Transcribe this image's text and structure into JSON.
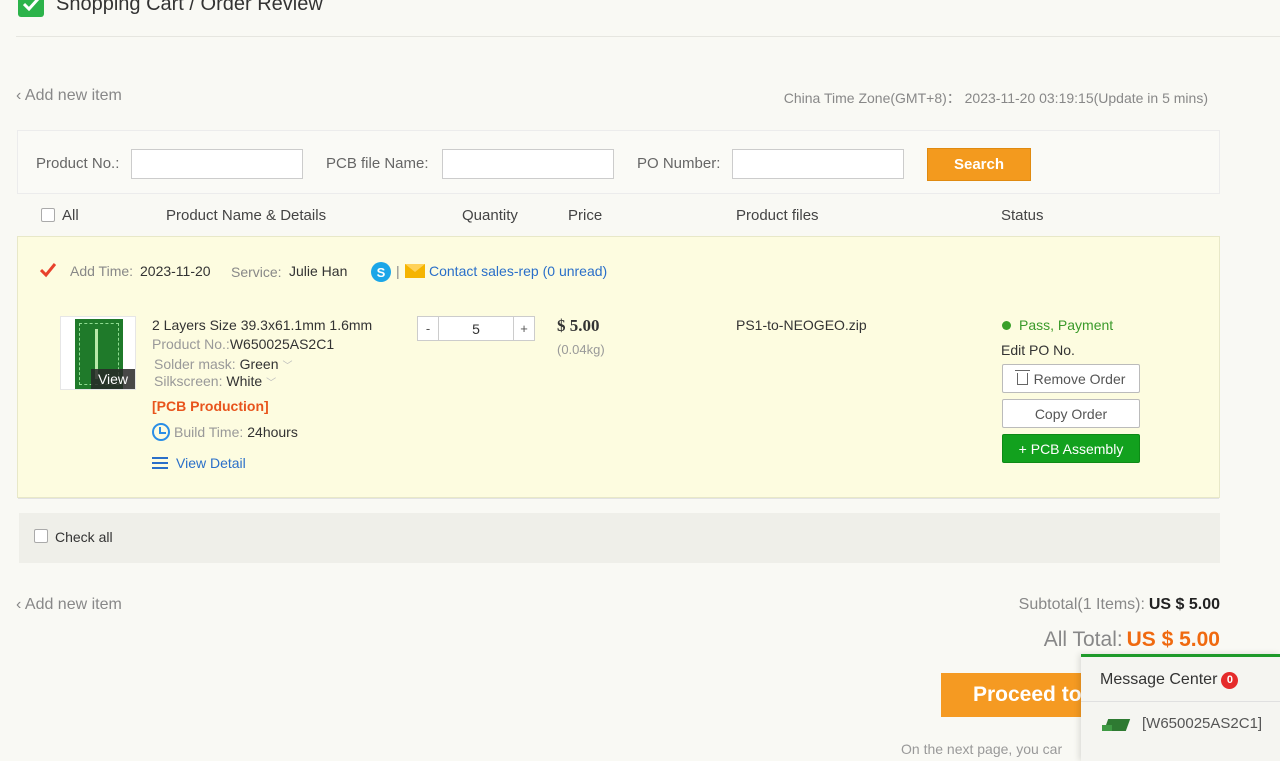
{
  "page": {
    "title": "Shopping Cart / Order Review",
    "add_new_item": "Add new item",
    "timezone_note": "China Time Zone(GMT+8)： 2023-11-20 03:19:15(Update in 5 mins)"
  },
  "search": {
    "product_no_label": "Product No.:",
    "pcb_file_label": "PCB file Name:",
    "po_number_label": "PO Number:",
    "product_no_value": "",
    "pcb_file_value": "",
    "po_number_value": "",
    "button": "Search"
  },
  "table_header": {
    "all": "All",
    "columns": [
      "Product Name & Details",
      "Quantity",
      "Price",
      "Product files",
      "Status"
    ]
  },
  "order": {
    "add_time_label": "Add Time:",
    "add_time": "2023-11-20",
    "service_label": "Service:",
    "service": "Julie Han",
    "separator": "|",
    "contact": "Contact sales-rep (0 unread)",
    "view_tag": "View",
    "spec": "2 Layers Size 39.3x61.1mm 1.6mm",
    "product_no_label": "Product No.:",
    "product_no": "W650025AS2C1",
    "solder_label": "Solder mask:",
    "solder": "Green",
    "silk_label": "Silkscreen:",
    "silk": "White",
    "production": "[PCB Production]",
    "build_label": "Build Time:",
    "build": "24hours",
    "view_detail": "View Detail",
    "quantity_minus": "-",
    "quantity": "5",
    "quantity_plus": "+",
    "price": "$ 5.00",
    "weight": "(0.04kg)",
    "file": "PS1-to-NEOGEO.zip",
    "status": "Pass, Payment",
    "edit_po": "Edit PO No.",
    "remove": "Remove Order",
    "copy": "Copy Order",
    "assembly": "+ PCB Assembly"
  },
  "footer": {
    "check_all": "Check all",
    "subtotal_label": "Subtotal(1 Items):",
    "subtotal": "US $ 5.00",
    "total_label": "All Total:",
    "total": "US $ 5.00",
    "proceed": "Proceed to",
    "next_note": "On the next page, you car"
  },
  "message_center": {
    "title": "Message Center",
    "count": "0",
    "item": "[W650025AS2C1]"
  },
  "colors": {
    "accent_orange": "#f39a1e",
    "total_orange": "#f06a10",
    "status_green": "#3a9a2a",
    "assembly_green": "#12a11e",
    "link_blue": "#2a6fc9",
    "order_panel_bg": "#fdfce0"
  },
  "icons": [
    "checkbox-checked-icon",
    "skype-icon",
    "mail-icon",
    "clock-icon",
    "list-icon",
    "trash-icon",
    "status-dot-icon",
    "chevron-down-icon",
    "pcb-thumbnail-icon"
  ]
}
